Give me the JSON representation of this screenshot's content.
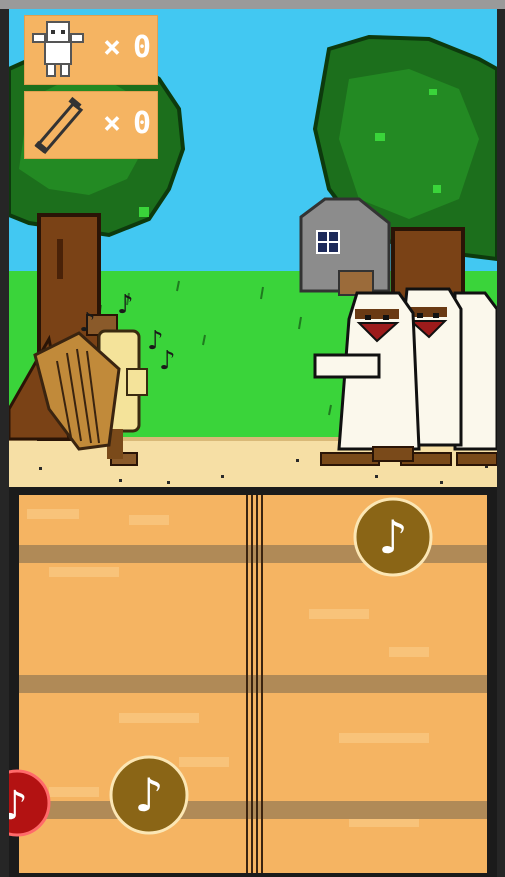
{
  "hud": {
    "rescued": {
      "icon": "white-figure-icon",
      "times": "×",
      "value": "0"
    },
    "scrolls": {
      "icon": "scroll-icon",
      "times": "×",
      "value": "0"
    }
  },
  "colors": {
    "sky": "#42c8f2",
    "grass": "#3ad43a",
    "ground": "#f6dfa5",
    "board": "#f5b462",
    "lane": "#b08a57",
    "note": "#8a6516",
    "blocked_note": "#b31212"
  },
  "board": {
    "notes": [
      {
        "id": "note-top-right",
        "glyph": "♪"
      },
      {
        "id": "note-bottom-left",
        "glyph": "♪"
      },
      {
        "id": "note-blocked-left",
        "glyph": "♪"
      }
    ]
  }
}
